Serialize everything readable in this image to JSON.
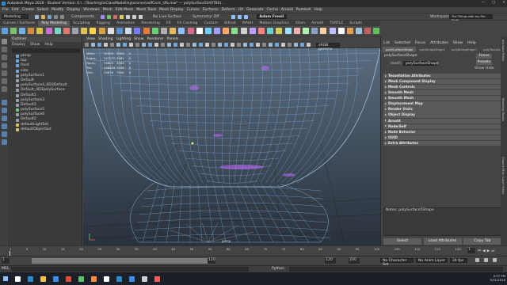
{
  "window": {
    "title": "Autodesk Maya 2018 - Student Version: E:\\...\\Teaching\\inClassModelling\\scenes\\selfCeric_Ufo.mw* --- polySurface5\\HOTB0)...",
    "min": "—",
    "max": "□",
    "close": "✕"
  },
  "menubar": [
    "File",
    "Edit",
    "Create",
    "Select",
    "Modify",
    "Display",
    "Windows",
    "Mesh",
    "Edit Mesh",
    "Mesh Tools",
    "Mesh Display",
    "Curves",
    "Surfaces",
    "Deform",
    "UV",
    "Generate",
    "Cache",
    "Arnold",
    "Rumball",
    "Help"
  ],
  "status": {
    "mode": "Modeling",
    "components": "Components",
    "live": "No Live Surface",
    "symmetry": "Symmetry: Off",
    "user": "Adam Freeli",
    "workspace": "Workspace :",
    "workspace_value": "The Things with my File Stuff"
  },
  "shelf": {
    "tabs": [
      "Curves / Surfaces",
      "Poly Modeling",
      "Sculpting",
      "Rigging",
      "Animation",
      "Rendering",
      "FX",
      "FX Caching",
      "Custom",
      "Bifrost",
      "MASH",
      "Motion Graphics",
      "XGen",
      "Arnold",
      "TURTLE",
      "Scripts"
    ],
    "active": 1,
    "icons": [
      "#5ea0dc",
      "#7ac26b",
      "#6fb1e0",
      "#d08b3c",
      "#d9c24a",
      "#c66fd0",
      "#7ad4c4",
      "#e07a6e",
      "#9ea3ad",
      "#e3c05a",
      "#ffd54a",
      "#d7a343",
      "#e0e0e0",
      "#5a8fd8",
      "#c9dcec",
      "#7a7aff",
      "#e47a3c",
      "#6ad07a",
      "#b0b0b0",
      "#e6b95c",
      "#8fc0ff",
      "#d86a8a",
      "#ffffff",
      "#6fd0ff",
      "#a0a0ff",
      "#ffa76a",
      "#8be08b",
      "#d0d0d0",
      "#c0a0ff",
      "#ff8080",
      "#6ad0d0",
      "#d0d060",
      "#a0e0ff",
      "#f0b0b0",
      "#b0f0b0",
      "#90a0c0",
      "#ffd0a0",
      "#c0c0ff",
      "#ffffff",
      "#e0a050",
      "#a0c0e0",
      "#c06060",
      "#60c060",
      "#6060c0"
    ]
  },
  "outliner": {
    "title": "Outliner",
    "menu": [
      "Display",
      "Show",
      "Help"
    ],
    "items": [
      {
        "label": "persp",
        "ic": "#6fa8dc"
      },
      {
        "label": "top",
        "ic": "#6fa8dc"
      },
      {
        "label": "front",
        "ic": "#6fa8dc"
      },
      {
        "label": "side",
        "ic": "#6fa8dc"
      },
      {
        "label": "polySurface1",
        "ic": "#9aa0a8"
      },
      {
        "label": "Default",
        "ic": "#9aa0a8"
      },
      {
        "label": "polySurface4_0D3Default",
        "ic": "#9aa0a8"
      },
      {
        "label": "Default_0D3polySurface",
        "ic": "#9aa0a8"
      },
      {
        "label": "Default1",
        "ic": "#9aa0a8"
      },
      {
        "label": "polySurface3",
        "ic": "#9aa0a8"
      },
      {
        "label": "Default3",
        "ic": "#9aa0a8"
      },
      {
        "label": "polySurface5",
        "ic": "#6fd07a"
      },
      {
        "label": "polySurface6",
        "ic": "#9aa0a8"
      },
      {
        "label": "Default2",
        "ic": "#9aa0a8"
      },
      {
        "label": "defaultLightSet",
        "ic": "#d7c26a"
      },
      {
        "label": "defaultObjectSet",
        "ic": "#d7c26a"
      }
    ]
  },
  "viewport": {
    "menu": [
      "View",
      "Shading",
      "Lighting",
      "Show",
      "Renderer",
      "Panels"
    ],
    "camera": "persp",
    "gamma": "sRGB gamma",
    "hud": [
      [
        "Verts:",
        "32959",
        "3959",
        "0"
      ],
      [
        "Edges:",
        "107570",
        "3981",
        "0"
      ],
      [
        "Faces:",
        "74603",
        "3963",
        "0"
      ],
      [
        "Tris:",
        "148976",
        "7936",
        "0"
      ],
      [
        "UVs:",
        "74876",
        "7940",
        "0"
      ]
    ]
  },
  "attr": {
    "menu": [
      "List",
      "Selected",
      "Focus",
      "Attributes",
      "Show",
      "Help"
    ],
    "tabs": [
      "polySurfaceShape",
      "polyBridgeEdge1",
      "polyBridgeEdge7",
      "polyTweakUV"
    ],
    "node_label": "polySurfaceShape",
    "mesh_label": "mesh:",
    "mesh_value": "polySurfaceShape",
    "focus": "Focus",
    "presets": "Presets",
    "show": "Show",
    "hide": "Hide",
    "sections": [
      "Tessellation Attributes",
      "Mesh Component Display",
      "Mesh Controls",
      "Smooth Mesh",
      "Smooth Mesh",
      "Displacement Map",
      "Render Stats",
      "Object Display",
      "Arnold",
      "Node/Self",
      "Node Behavior",
      "UUID",
      "Extra Attributes"
    ],
    "notes_label": "Notes: polySurface5Shape",
    "buttons": [
      "Select",
      "Load Attributes",
      "Copy Tab"
    ]
  },
  "sidetabs": [
    "Attribute Editor",
    "Modeling Toolkit",
    "Channel Box / Layer Editor"
  ],
  "timeline": {
    "ticks": [
      "1",
      "5",
      "10",
      "15",
      "20",
      "25",
      "30",
      "35",
      "40",
      "45",
      "50",
      "55",
      "60",
      "65",
      "70",
      "75",
      "80",
      "85",
      "90",
      "95",
      "100",
      "105",
      "110",
      "115",
      "120"
    ],
    "current": "1",
    "start": "1",
    "end": "120",
    "range_end": "120",
    "range_max": "200",
    "fps": "24 fps",
    "char_set": "No Character Set",
    "anim_layer": "No Anim Layer"
  },
  "cmdline": {
    "label": "MEL",
    "lang": "Python"
  },
  "taskbar": {
    "time": "5:57 PM",
    "date": "5/31/2018",
    "search": "Type here to search"
  }
}
